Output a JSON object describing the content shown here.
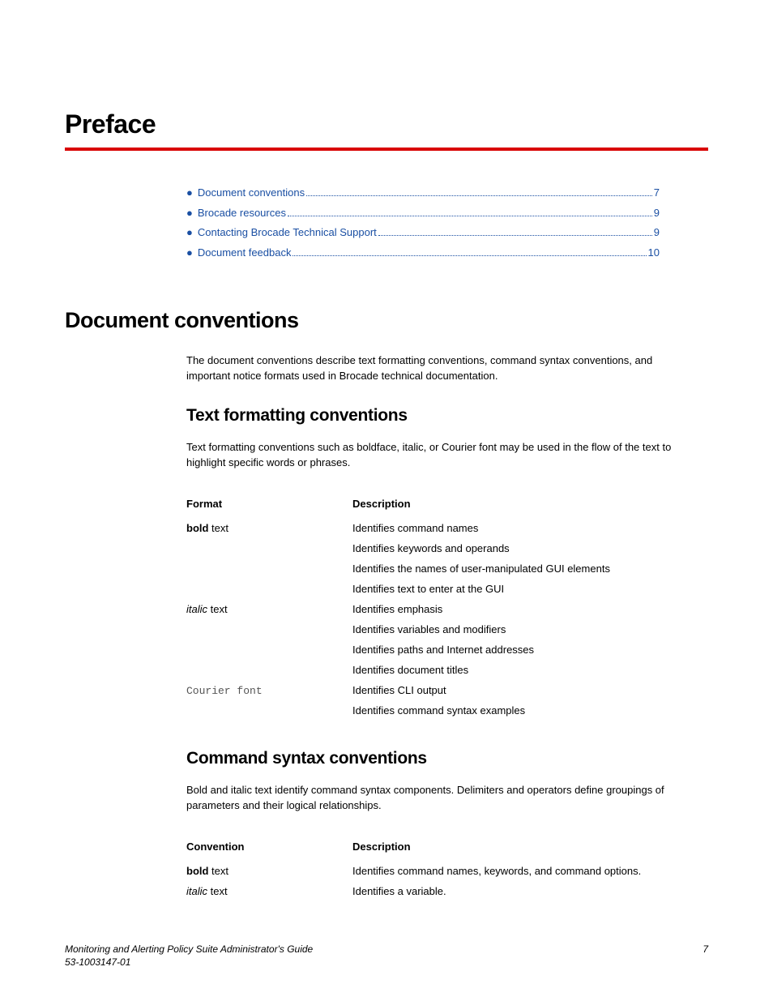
{
  "title": "Preface",
  "toc": [
    {
      "label": "Document conventions",
      "page": "7"
    },
    {
      "label": "Brocade resources",
      "page": "9"
    },
    {
      "label": "Contacting Brocade Technical Support",
      "page": "9"
    },
    {
      "label": "Document feedback",
      "page": "10"
    }
  ],
  "section1": {
    "heading": "Document conventions",
    "intro": "The document conventions describe text formatting conventions, command syntax conventions, and important notice formats used in Brocade technical documentation."
  },
  "section2": {
    "heading": "Text formatting conventions",
    "intro": "Text formatting conventions such as boldface, italic, or Courier font may be used in the flow of the text to highlight specific words or phrases.",
    "header_format": "Format",
    "header_desc": "Description",
    "rows": [
      {
        "fmt_prefix": "bold",
        "fmt_suffix": " text",
        "fmt_class": "bold-part",
        "desc": [
          "Identifies command names",
          "Identifies keywords and operands",
          "Identifies the names of user-manipulated GUI elements",
          "Identifies text to enter at the GUI"
        ]
      },
      {
        "fmt_prefix": "italic",
        "fmt_suffix": " text",
        "fmt_class": "italic-part",
        "desc": [
          "Identifies emphasis",
          "Identifies variables and modifiers",
          "Identifies paths and Internet addresses",
          "Identifies document titles"
        ]
      },
      {
        "fmt_prefix": "Courier font",
        "fmt_suffix": "",
        "fmt_class": "courier-part",
        "desc": [
          "Identifies CLI output",
          "Identifies command syntax examples"
        ]
      }
    ]
  },
  "section3": {
    "heading": "Command syntax conventions",
    "intro": "Bold and italic text identify command syntax components. Delimiters and operators define groupings of parameters and their logical relationships.",
    "header_conv": "Convention",
    "header_desc": "Description",
    "rows": [
      {
        "fmt_prefix": "bold",
        "fmt_suffix": " text",
        "fmt_class": "bold-part",
        "desc": "Identifies command names, keywords, and command options."
      },
      {
        "fmt_prefix": "italic",
        "fmt_suffix": " text",
        "fmt_class": "italic-part",
        "desc": "Identifies a variable."
      }
    ]
  },
  "footer": {
    "title": "Monitoring and Alerting Policy Suite Administrator's Guide",
    "docnum": "53-1003147-01",
    "page": "7"
  }
}
